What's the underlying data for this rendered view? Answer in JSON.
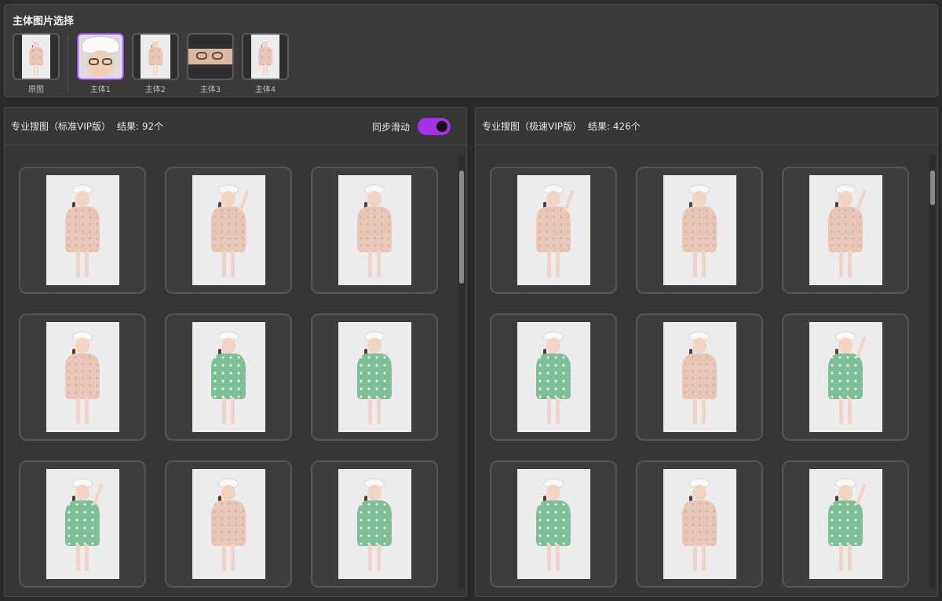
{
  "selector": {
    "title": "主体图片选择",
    "thumbs": [
      {
        "label": "原图",
        "variant": "pink-full",
        "selected": false
      },
      {
        "label": "主体1",
        "variant": "face-hat",
        "selected": true
      },
      {
        "label": "主体2",
        "variant": "pink-torso",
        "selected": false
      },
      {
        "label": "主体3",
        "variant": "glasses",
        "selected": false
      },
      {
        "label": "主体4",
        "variant": "pink-full",
        "selected": false
      }
    ]
  },
  "left_panel": {
    "title": "专业搜图（标准VIP版）",
    "results": "结果: 92个",
    "sync_label": "同步滑动",
    "sync_on": true,
    "scroll_fraction": 0.0,
    "images": [
      {
        "dress": "pink",
        "pose": "arms-down"
      },
      {
        "dress": "pink",
        "pose": "hand-up"
      },
      {
        "dress": "pink",
        "pose": "arms-down"
      },
      {
        "dress": "pink",
        "pose": "full"
      },
      {
        "dress": "green",
        "pose": "full"
      },
      {
        "dress": "green",
        "pose": "full"
      },
      {
        "dress": "green",
        "pose": "hand-up"
      },
      {
        "dress": "pink",
        "pose": "arms-down"
      },
      {
        "dress": "green",
        "pose": "arms-down"
      }
    ]
  },
  "right_panel": {
    "title": "专业搜图（极速VIP版）",
    "results": "结果: 426个",
    "scroll_fraction": 0.0,
    "images": [
      {
        "dress": "pink",
        "pose": "hand-up"
      },
      {
        "dress": "pink",
        "pose": "arms-down"
      },
      {
        "dress": "pink",
        "pose": "hand-up"
      },
      {
        "dress": "green",
        "pose": "full"
      },
      {
        "dress": "pink",
        "pose": "full"
      },
      {
        "dress": "green",
        "pose": "hand-up"
      },
      {
        "dress": "green",
        "pose": "full"
      },
      {
        "dress": "pink",
        "pose": "arms-down"
      },
      {
        "dress": "green",
        "pose": "hand-up"
      }
    ]
  },
  "colors": {
    "accent": "#9a4ae6",
    "toggle": "#a532e6",
    "background": "#2b2b2b",
    "panel": "#363636"
  }
}
